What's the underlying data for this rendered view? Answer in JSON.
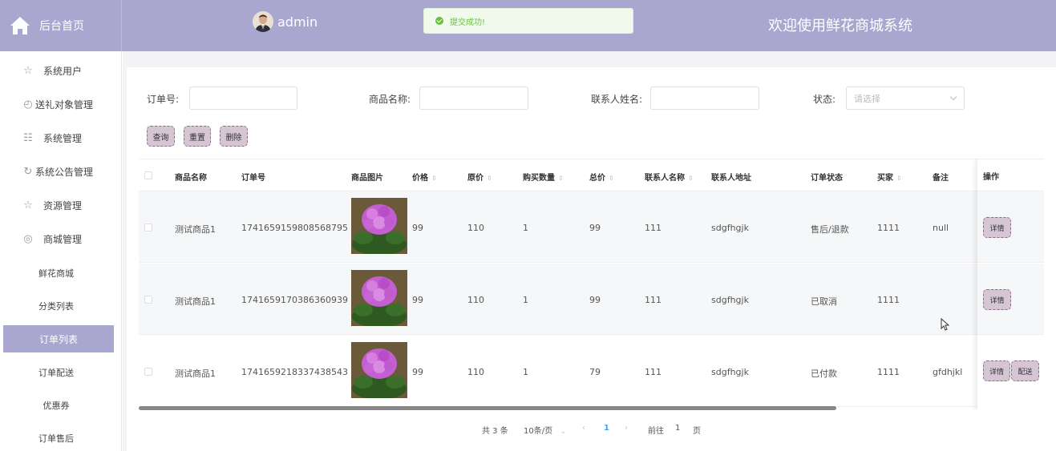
{
  "header": {
    "home_label": "后台首页",
    "username": "admin",
    "toast": "提交成功!",
    "welcome": "欢迎使用鲜花商城系统"
  },
  "sidebar": {
    "items": [
      {
        "label": "系统用户",
        "icon": "star-icon"
      },
      {
        "label": "送礼对象管理",
        "icon": "clock-icon"
      },
      {
        "label": "系统管理",
        "icon": "basket-icon"
      },
      {
        "label": "系统公告管理",
        "icon": "refresh-icon"
      },
      {
        "label": "资源管理",
        "icon": "star-icon"
      },
      {
        "label": "商城管理",
        "icon": "compass-icon"
      }
    ],
    "submenu": [
      {
        "label": "鲜花商城"
      },
      {
        "label": "分类列表"
      },
      {
        "label": "订单列表",
        "active": true
      },
      {
        "label": "订单配送"
      },
      {
        "label": "优惠券"
      },
      {
        "label": "订单售后"
      }
    ]
  },
  "search": {
    "order_no_label": "订单号:",
    "order_no_value": "",
    "goods_name_label": "商品名称:",
    "goods_name_value": "",
    "contact_name_label": "联系人姓名:",
    "contact_name_value": "",
    "status_label": "状态:",
    "status_placeholder": "请选择"
  },
  "actions": {
    "query": "查询",
    "reset": "重置",
    "delete": "删除"
  },
  "table": {
    "columns": [
      {
        "label": "商品名称",
        "sortable": false
      },
      {
        "label": "订单号",
        "sortable": false
      },
      {
        "label": "商品图片",
        "sortable": false
      },
      {
        "label": "价格",
        "sortable": true
      },
      {
        "label": "原价",
        "sortable": true
      },
      {
        "label": "购买数量",
        "sortable": true
      },
      {
        "label": "总价",
        "sortable": true
      },
      {
        "label": "联系人名称",
        "sortable": true
      },
      {
        "label": "联系人地址",
        "sortable": false
      },
      {
        "label": "订单状态",
        "sortable": false
      },
      {
        "label": "买家",
        "sortable": true
      },
      {
        "label": "备注",
        "sortable": false
      },
      {
        "label": "操作",
        "sortable": false
      }
    ],
    "rows": [
      {
        "name": "测试商品1",
        "order_no": "1741659159808568795",
        "price": "99",
        "orig_price": "110",
        "qty": "1",
        "total": "99",
        "contact": "111",
        "address": "sdgfhgjk",
        "status": "售后/退款",
        "buyer": "1111",
        "remark": "null",
        "buttons": [
          "详情"
        ]
      },
      {
        "name": "测试商品1",
        "order_no": "1741659170386360939",
        "price": "99",
        "orig_price": "110",
        "qty": "1",
        "total": "99",
        "contact": "111",
        "address": "sdgfhgjk",
        "status": "已取消",
        "buyer": "1111",
        "remark": "",
        "buttons": [
          "详情"
        ]
      },
      {
        "name": "测试商品1",
        "order_no": "1741659218337438543",
        "price": "99",
        "orig_price": "110",
        "qty": "1",
        "total": "79",
        "contact": "111",
        "address": "sdgfhgjk",
        "status": "已付款",
        "buyer": "1111",
        "remark": "gfdhjkl",
        "buttons": [
          "详情",
          "配送"
        ]
      }
    ]
  },
  "pagination": {
    "total": "共 3 条",
    "page_size": "10条/页",
    "prev": "‹",
    "current": "1",
    "next": "›",
    "goto_label": "前往",
    "goto_value": "1",
    "page_unit": "页"
  },
  "colors": {
    "header_bg": "#a9a6cf",
    "active_menu": "#a9a6cf",
    "button_bg": "#d6c5d2",
    "success": "#67c23a"
  }
}
